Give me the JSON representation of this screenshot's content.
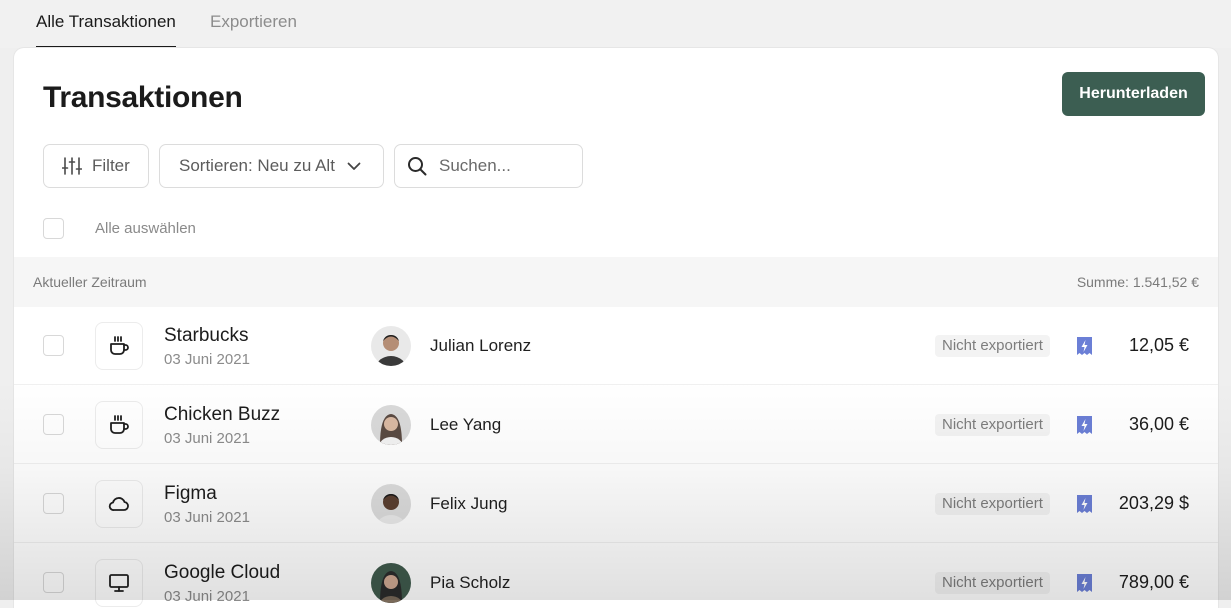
{
  "tabs": [
    {
      "label": "Alle Transaktionen",
      "active": true
    },
    {
      "label": "Exportieren",
      "active": false
    }
  ],
  "header": {
    "title": "Transaktionen",
    "download_label": "Herunterladen"
  },
  "toolbar": {
    "filter_label": "Filter",
    "sort_label": "Sortieren: Neu zu Alt",
    "search_placeholder": "Suchen..."
  },
  "select_all_label": "Alle auswählen",
  "period": {
    "label": "Aktueller Zeitraum",
    "sum": "Summe: 1.541,52 €"
  },
  "transactions": [
    {
      "merchant": "Starbucks",
      "date": "03 Juni 2021",
      "category_icon": "coffee-cup-icon",
      "person": "Julian Lorenz",
      "status": "Nicht exportiert",
      "amount": "12,05 €"
    },
    {
      "merchant": "Chicken Buzz",
      "date": "03 Juni 2021",
      "category_icon": "coffee-cup-icon",
      "person": "Lee Yang",
      "status": "Nicht exportiert",
      "amount": "36,00 €"
    },
    {
      "merchant": "Figma",
      "date": "03 Juni 2021",
      "category_icon": "cloud-icon",
      "person": "Felix Jung",
      "status": "Nicht exportiert",
      "amount": "203,29 $"
    },
    {
      "merchant": "Google Cloud",
      "date": "03 Juni 2021",
      "category_icon": "monitor-icon",
      "person": "Pia Scholz",
      "status": "Nicht exportiert",
      "amount": "789,00 €"
    }
  ],
  "colors": {
    "accent": "#3c5e52",
    "bolt": "#6b7fd6"
  }
}
